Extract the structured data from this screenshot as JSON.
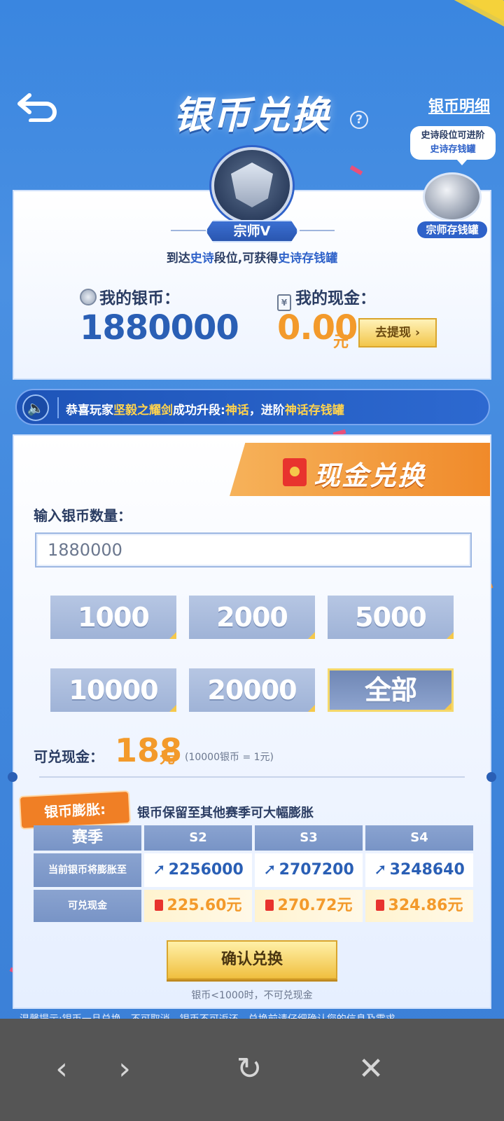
{
  "header": {
    "title": "银币兑换",
    "help_icon": "?",
    "detail_link": "银币明细"
  },
  "tip_bubble": {
    "line1": "史诗段位可进阶",
    "line2": "史诗存钱罐"
  },
  "piggy_bank": {
    "label": "宗师存钱罐"
  },
  "rank": {
    "name": "宗师V",
    "desc_prefix": "到达",
    "desc_highlight1": "史诗",
    "desc_mid": "段位,可获得",
    "desc_highlight2": "史诗存钱罐"
  },
  "balance": {
    "silver_label": "我的银币：",
    "silver_value": "1880000",
    "cash_label": "我的现金：",
    "cash_value": "0.00",
    "cash_unit": "元",
    "withdraw_button": "去提现 ›"
  },
  "ticker": {
    "part1": "恭喜玩家",
    "player": "坚毅之耀剑",
    "part2": "成功升段:",
    "rank": "神话",
    "part3": "，进阶",
    "reward": "神话存钱罐"
  },
  "exchange": {
    "tab_title": "现金兑换",
    "input_label": "输入银币数量：",
    "input_value": "1880000",
    "amount_buttons": [
      "1000",
      "2000",
      "5000",
      "10000",
      "20000",
      "全部"
    ],
    "selected_amount_index": 5,
    "redeem_label": "可兑现金：",
    "redeem_value": "188",
    "redeem_unit": "元",
    "rate_note": "(10000银币 = 1元)"
  },
  "inflation": {
    "badge": "银币膨胀:",
    "desc": "银币保留至其他赛季可大幅膨胀",
    "table": {
      "header_first": "赛季",
      "seasons": [
        "S2",
        "S3",
        "S4"
      ],
      "row1_label": "当前银币将膨胀至",
      "row1_values": [
        "2256000",
        "2707200",
        "3248640"
      ],
      "row2_label": "可兑现金",
      "row2_values": [
        "225.60元",
        "270.72元",
        "324.86元"
      ]
    }
  },
  "confirm_button": "确认兑换",
  "min_note": "银币<1000时，不可兑现金",
  "warm_tip": "温馨提示:银币一旦兑换，不可取消，银币不可返还，兑换前请仔细确认您的信息及需求。",
  "nav": {
    "back": "‹",
    "forward": "›",
    "refresh": "↻",
    "close": "✕"
  },
  "colors": {
    "accent_blue": "#2a5fb5",
    "accent_orange": "#f39a2b",
    "gold": "#f0c040"
  }
}
